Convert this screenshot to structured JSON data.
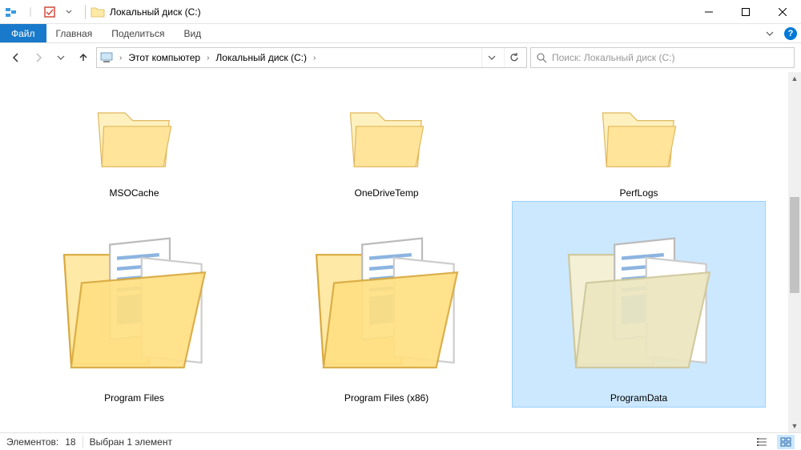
{
  "titlebar": {
    "title": "Локальный диск (C:)"
  },
  "ribbon": {
    "file": "Файл",
    "tabs": [
      "Главная",
      "Поделиться",
      "Вид"
    ]
  },
  "address": {
    "crumbs": [
      "Этот компьютер",
      "Локальный диск (C:)"
    ]
  },
  "search": {
    "placeholder": "Поиск: Локальный диск (C:)"
  },
  "items": [
    {
      "label": "MSOCache",
      "kind": "folder-empty",
      "size": "small",
      "selected": false
    },
    {
      "label": "OneDriveTemp",
      "kind": "folder-empty",
      "size": "small",
      "selected": false
    },
    {
      "label": "PerfLogs",
      "kind": "folder-empty",
      "size": "small",
      "selected": false
    },
    {
      "label": "Program Files",
      "kind": "folder-docs",
      "size": "large",
      "selected": false
    },
    {
      "label": "Program Files (x86)",
      "kind": "folder-docs",
      "size": "large",
      "selected": false
    },
    {
      "label": "ProgramData",
      "kind": "folder-docs",
      "size": "large",
      "selected": true
    }
  ],
  "status": {
    "count_label": "Элементов:",
    "count_value": "18",
    "selection": "Выбран 1 элемент"
  }
}
